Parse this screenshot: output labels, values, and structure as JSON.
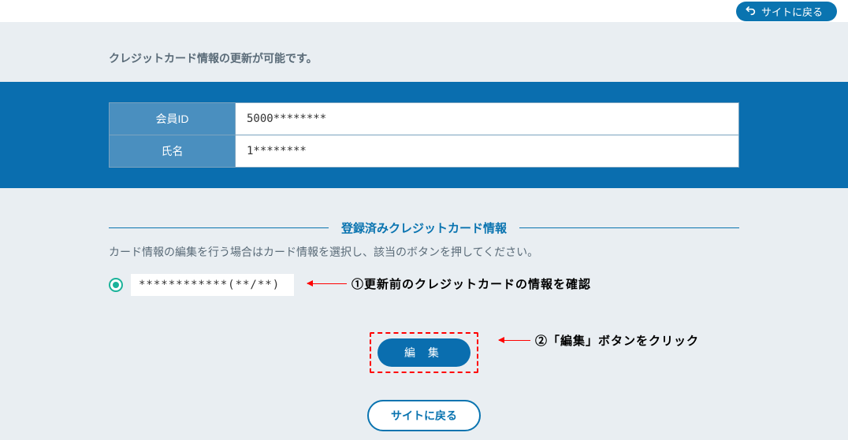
{
  "header": {
    "back_to_site": "サイトに戻る"
  },
  "subtitle": "クレジットカード情報の更新が可能です。",
  "member": {
    "id_label": "会員ID",
    "id_value": "5000********",
    "name_label": "氏名",
    "name_value": "1********"
  },
  "section": {
    "title": "登録済みクレジットカード情報",
    "desc": "カード情報の編集を行う場合はカード情報を選択し、該当のボタンを押してください。"
  },
  "card": {
    "masked": "************(**/**)"
  },
  "buttons": {
    "edit": "編 集",
    "back": "サイトに戻る"
  },
  "annotations": {
    "one": "①更新前のクレジットカードの情報を確認",
    "two": "②「編集」ボタンをクリック"
  }
}
